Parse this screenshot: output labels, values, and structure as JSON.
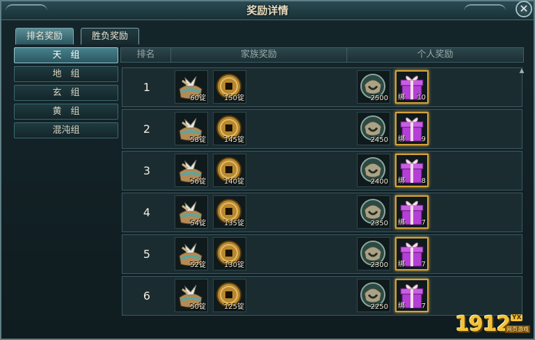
{
  "window": {
    "title": "奖励详情",
    "close_label": "✕"
  },
  "tabs": [
    {
      "label": "排名奖励",
      "active": true
    },
    {
      "label": "胜负奖励",
      "active": false
    }
  ],
  "groups": [
    {
      "label": "天　组",
      "selected": true
    },
    {
      "label": "地　组",
      "selected": false
    },
    {
      "label": "玄　组",
      "selected": false
    },
    {
      "label": "黄　组",
      "selected": false
    },
    {
      "label": "混沌组",
      "selected": false
    }
  ],
  "table": {
    "headers": {
      "rank": "排名",
      "family": "家族奖励",
      "personal": "个人奖励"
    },
    "rows": [
      {
        "rank": "1",
        "family_silver": "60锭",
        "family_coin": "150锭",
        "personal_helm": "2500",
        "gift_bind": "绑",
        "gift_count": "10"
      },
      {
        "rank": "2",
        "family_silver": "58锭",
        "family_coin": "145锭",
        "personal_helm": "2450",
        "gift_bind": "绑",
        "gift_count": "9"
      },
      {
        "rank": "3",
        "family_silver": "56锭",
        "family_coin": "140锭",
        "personal_helm": "2400",
        "gift_bind": "绑",
        "gift_count": "8"
      },
      {
        "rank": "4",
        "family_silver": "54锭",
        "family_coin": "135锭",
        "personal_helm": "2350",
        "gift_bind": "绑",
        "gift_count": "7"
      },
      {
        "rank": "5",
        "family_silver": "52锭",
        "family_coin": "130锭",
        "personal_helm": "2300",
        "gift_bind": "绑",
        "gift_count": "7"
      },
      {
        "rank": "6",
        "family_silver": "50锭",
        "family_coin": "125锭",
        "personal_helm": "2250",
        "gift_bind": "绑",
        "gift_count": "7"
      }
    ]
  },
  "icons": {
    "silver_bag": "silver-ingot-bag-icon",
    "coin": "copper-coin-icon",
    "helm": "bronze-mask-icon",
    "gift": "purple-gift-box-icon"
  },
  "colors": {
    "gift_border": "#d8a23a",
    "selected_tab": "#47808a",
    "gift_purple": "#b43fd6"
  },
  "watermark": {
    "number": "1912",
    "badge": "YX",
    "sub": "网页游戏"
  }
}
